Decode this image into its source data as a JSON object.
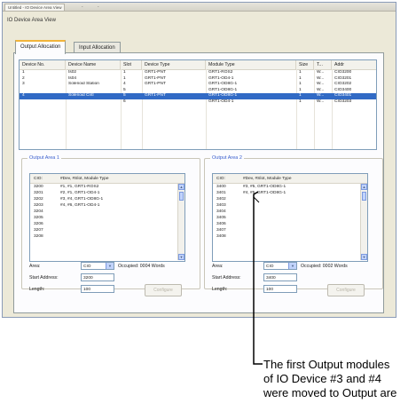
{
  "titlebar": {
    "tabs": [
      "Untitled - IO Device Area View",
      "-",
      "-"
    ]
  },
  "dialog": {
    "title": "IO Device Area View"
  },
  "tabs": [
    {
      "label": "Output Allocation",
      "active": true
    },
    {
      "label": "Input Allocation",
      "active": false
    }
  ],
  "device_table": {
    "columns": [
      "Device No.",
      "Device Name",
      "Slot",
      "Device Type",
      "Module Type",
      "Size",
      "T...",
      "Addr"
    ],
    "rows": [
      {
        "no": "1",
        "name": "ts02",
        "slot": "1",
        "type": "GRT1-PNT",
        "module": "GRT1-ROS2",
        "size": "1",
        "t": "W...",
        "addr": "CIO3200",
        "selected": false
      },
      {
        "no": "2",
        "name": "ts04",
        "slot": "1",
        "type": "GRT1-PNT",
        "module": "GRT1-OD4-1",
        "size": "1",
        "t": "W...",
        "addr": "CIO3201",
        "selected": false
      },
      {
        "no": "3",
        "name": "Solenoid Station",
        "slot": "4",
        "type": "GRT1-PNT",
        "module": "GRT1-OD8G-1",
        "size": "1",
        "t": "W...",
        "addr": "CIO3202",
        "selected": false
      },
      {
        "no": "",
        "name": "",
        "slot": "5",
        "type": "",
        "module": "GRT1-OD8G-1",
        "size": "1",
        "t": "W...",
        "addr": "CIO3400",
        "selected": false
      },
      {
        "no": "4",
        "name": "Solenoid Cntl",
        "slot": "5",
        "type": "GRT1-PNT",
        "module": "GRT1-OD8G-1",
        "size": "1",
        "t": "W...",
        "addr": "CIO3401",
        "selected": true
      },
      {
        "no": "",
        "name": "",
        "slot": "6",
        "type": "",
        "module": "GRT1-OD4-1",
        "size": "1",
        "t": "W...",
        "addr": "CIO3203",
        "selected": false
      }
    ]
  },
  "output_area_1": {
    "label": "Output Area 1",
    "header": {
      "cio": "CIO:",
      "module": "#Dev, #Slot, Module Type"
    },
    "rows": [
      {
        "cio": "3200",
        "module": "#1, #1, GRT1-ROS2"
      },
      {
        "cio": "3201",
        "module": "#2, #1, GRT1-OD4-1"
      },
      {
        "cio": "3202",
        "module": "#3, #4, GRT1-OD8G-1"
      },
      {
        "cio": "3203",
        "module": "#4, #6, GRT1-OD4-1"
      },
      {
        "cio": "3204",
        "module": ""
      },
      {
        "cio": "3205",
        "module": ""
      },
      {
        "cio": "3206",
        "module": ""
      },
      {
        "cio": "3207",
        "module": ""
      },
      {
        "cio": "3208",
        "module": ""
      }
    ],
    "area_label": "Area:",
    "area_value": "CIO",
    "occupied_label": "Occupied: 0004  Words",
    "start_label": "Start Address:",
    "start_value": "3200",
    "length_label": "Length:",
    "length_value": "100",
    "button": "Configure"
  },
  "output_area_2": {
    "label": "Output Area 2",
    "header": {
      "cio": "CIO:",
      "module": "#Dev, #Slot, Module Type"
    },
    "rows": [
      {
        "cio": "3400",
        "module": "#3, #5, GRT1-OD8G-1"
      },
      {
        "cio": "3401",
        "module": "#4, #5, GRT1-OD8G-1"
      },
      {
        "cio": "3402",
        "module": ""
      },
      {
        "cio": "3403",
        "module": ""
      },
      {
        "cio": "3404",
        "module": ""
      },
      {
        "cio": "3405",
        "module": ""
      },
      {
        "cio": "3406",
        "module": ""
      },
      {
        "cio": "3407",
        "module": ""
      },
      {
        "cio": "3408",
        "module": ""
      }
    ],
    "area_label": "Area:",
    "area_value": "CIO",
    "occupied_label": "Occupied: 0002  Words",
    "start_label": "Start Address:",
    "start_value": "3400",
    "length_label": "Length:",
    "length_value": "100",
    "button": "Configure"
  },
  "annotation": {
    "lines": [
      "The first Output modules",
      "of IO Device #3 and  #4",
      "were moved to Output are"
    ]
  }
}
